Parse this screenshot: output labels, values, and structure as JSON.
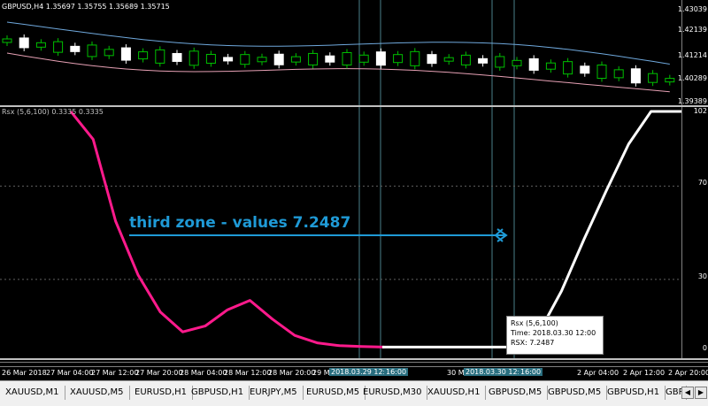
{
  "price_chart": {
    "title": "GBPUSD,H4  1.35697 1.35755 1.35689 1.35715",
    "yticks": [
      "1.43039",
      "1.42139",
      "1.41214",
      "1.40289",
      "1.39389"
    ]
  },
  "indicator": {
    "title": "Rsx (5,6,100) 0.3335 0.3335",
    "yticks": [
      "102",
      "70",
      "30",
      "0"
    ],
    "series_colors": {
      "first": "#ff1a8c",
      "second": "#ffffff"
    }
  },
  "annotation": {
    "text": "third zone - values 7.2487",
    "color": "#1f9ad6"
  },
  "tooltip": {
    "line1": "Rsx (5,6,100)",
    "line2": "Time: 2018.03.30 12:00",
    "line3": "RSX: 7.2487"
  },
  "time_axis": [
    "26 Mar 2018",
    "27 Mar 04:00",
    "27 Mar 12:00",
    "27 Mar 20:00",
    "28 Mar 04:00",
    "28 Mar 12:00",
    "28 Mar 20:00",
    "29 Mar",
    "2018.03.29 12:00",
    "16:00",
    "30 Mar",
    "2018.03.30 12:00",
    "16:00",
    "2 Apr 04:00",
    "2 Apr 12:00",
    "2 Apr 20:00"
  ],
  "tabs": [
    "XAUUSD,M1",
    "XAUUSD,M5",
    "EURUSD,H1",
    "GBPUSD,H1",
    "EURJPY,M5",
    "EURUSD,M5",
    "EURUSD,M30",
    "XAUUSD,H1",
    "GBPUSD,M5",
    "GBPUSD,M5",
    "GBPUSD,H1",
    "GBP"
  ],
  "chart_data": {
    "type": "line",
    "title": "Rsx (5,6,100)",
    "ylim": [
      0,
      102
    ],
    "series": [
      {
        "name": "Rsx (5,6,100)",
        "color": "#ff1a8c",
        "values": [
          102,
          90,
          55,
          32,
          16,
          7.5,
          10,
          17,
          21,
          13,
          6,
          2.8,
          1.6,
          1.2,
          1.0
        ]
      },
      {
        "name": "Rsx (5,6,100)",
        "color": "#ffffff",
        "values": [
          1.0,
          1.0,
          1.0,
          1.0,
          1.0,
          1.0,
          1.0,
          7.2487,
          25,
          47,
          68,
          88,
          102,
          102,
          102,
          102
        ]
      }
    ]
  }
}
